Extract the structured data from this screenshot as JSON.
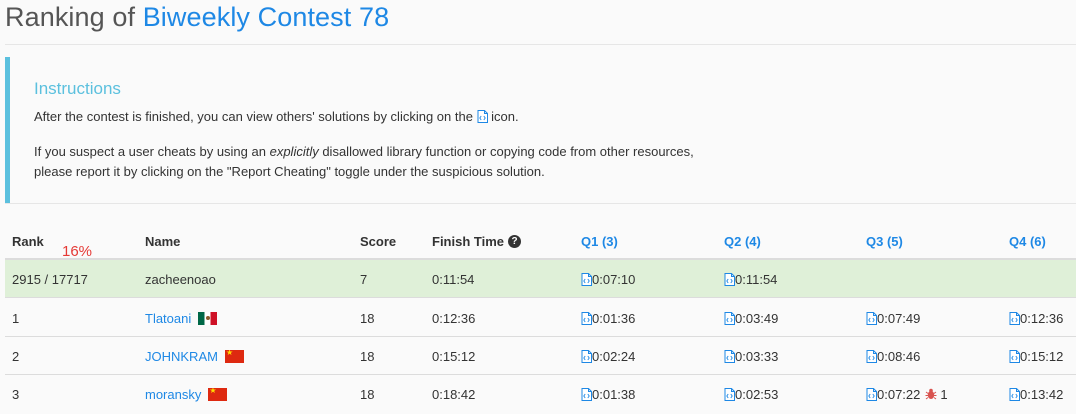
{
  "header": {
    "title_prefix": "Ranking of ",
    "contest_name": "Biweekly Contest 78"
  },
  "instructions": {
    "title": "Instructions",
    "line1_before_icon": "After the contest is finished, you can view others' solutions by clicking on the ",
    "line1_after_icon": " icon.",
    "line2_before_em": "If you suspect a user cheats by using an ",
    "line2_em": "explicitly",
    "line2_after_em": " disallowed library function or copying code from other resources,",
    "line3": "please report it by clicking on the \"Report Cheating\" toggle under the suspicious solution."
  },
  "table": {
    "columns": {
      "rank": "Rank",
      "name": "Name",
      "score": "Score",
      "finish_time": "Finish Time",
      "q1": "Q1 (3)",
      "q2": "Q2 (4)",
      "q3": "Q3 (5)",
      "q4": "Q4 (6)"
    },
    "percent_badge": "16%",
    "rows": [
      {
        "rank": "2915 / 17717",
        "name": "zacheenoao",
        "flag": "",
        "score": "7",
        "finish": "0:11:54",
        "q1": "0:07:10",
        "q2": "0:11:54",
        "q3": "",
        "q4": ""
      },
      {
        "rank": "1",
        "name": "Tlatoani",
        "flag": "mexico-flag-icon",
        "score": "18",
        "finish": "0:12:36",
        "q1": "0:01:36",
        "q2": "0:03:49",
        "q3": "0:07:49",
        "q4": "0:12:36"
      },
      {
        "rank": "2",
        "name": "JOHNKRAM",
        "flag": "china-flag-icon",
        "score": "18",
        "finish": "0:15:12",
        "q1": "0:02:24",
        "q2": "0:03:33",
        "q3": "0:08:46",
        "q4": "0:15:12"
      },
      {
        "rank": "3",
        "name": "moransky",
        "flag": "china-flag-icon",
        "score": "18",
        "finish": "0:18:42",
        "q1": "0:01:38",
        "q2": "0:02:53",
        "q3": "0:07:22",
        "q3_bugs": "1",
        "q4": "0:13:42"
      }
    ]
  },
  "colors": {
    "accent_blue": "#1e88e5",
    "info_border": "#5bc0de",
    "my_row_bg": "#dff0d8",
    "percent_red": "#e53935"
  }
}
